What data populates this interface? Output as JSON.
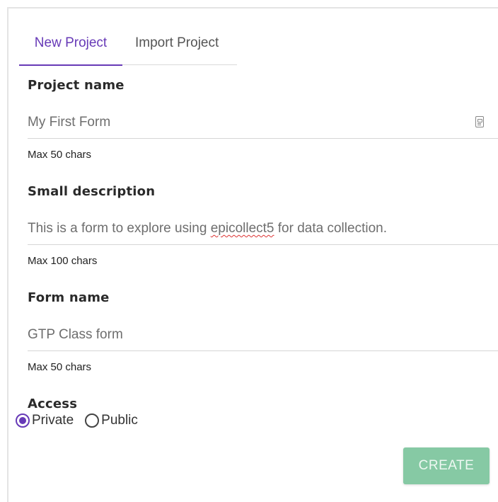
{
  "tabs": [
    {
      "label": "New Project",
      "active": true
    },
    {
      "label": "Import Project",
      "active": false
    }
  ],
  "project_name": {
    "label": "Project name",
    "value": "My First Form",
    "hint": "Max 50 chars"
  },
  "description": {
    "label": "Small description",
    "value_before": "This is a form to explore using ",
    "value_misspelled": "epicollect5",
    "value_after": " for data collection.",
    "hint": "Max 100 chars"
  },
  "form_name": {
    "label": "Form name",
    "value": "GTP Class form",
    "hint": "Max 50 chars"
  },
  "access": {
    "label": "Access",
    "options": [
      {
        "label": "Private",
        "checked": true
      },
      {
        "label": "Public",
        "checked": false
      }
    ]
  },
  "create_button": {
    "label": "CREATE"
  },
  "colors": {
    "accent": "#673ab7",
    "button": "#86c9a4"
  }
}
